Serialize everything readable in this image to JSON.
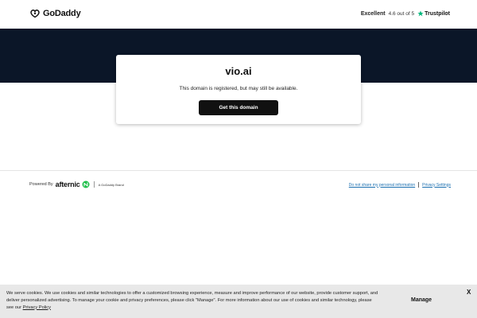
{
  "header": {
    "logo_text": "GoDaddy",
    "rating": {
      "label": "Excellent",
      "score": "4.6 out of 5",
      "provider": "Trustpilot"
    }
  },
  "card": {
    "domain": "vio.ai",
    "status": "This domain is registered, but may still be available.",
    "cta_label": "Get this domain"
  },
  "footer": {
    "powered_by": "Powered By",
    "partner": "afternic",
    "brand_note": "A GoDaddy Brand",
    "links": [
      "Do not share my personal information",
      "Privacy Settings"
    ]
  },
  "cookie_banner": {
    "text": "We serve cookies. We use cookies and similar technologies to offer a customized browsing experience, measure and improve performance of our website, provide customer support, and deliver personalized advertising. To manage your cookie and privacy preferences, please click \"Manage\". For more information about our use of cookies and similar technology, please see our",
    "policy_link": "Privacy Policy",
    "manage_label": "Manage",
    "close_label": "X"
  },
  "colors": {
    "hero_bg": "#0b1628",
    "button_bg": "#111111",
    "trustpilot_green": "#00b67a",
    "afternic_green": "#1fbf4a",
    "link_blue": "#1a6fb0"
  }
}
